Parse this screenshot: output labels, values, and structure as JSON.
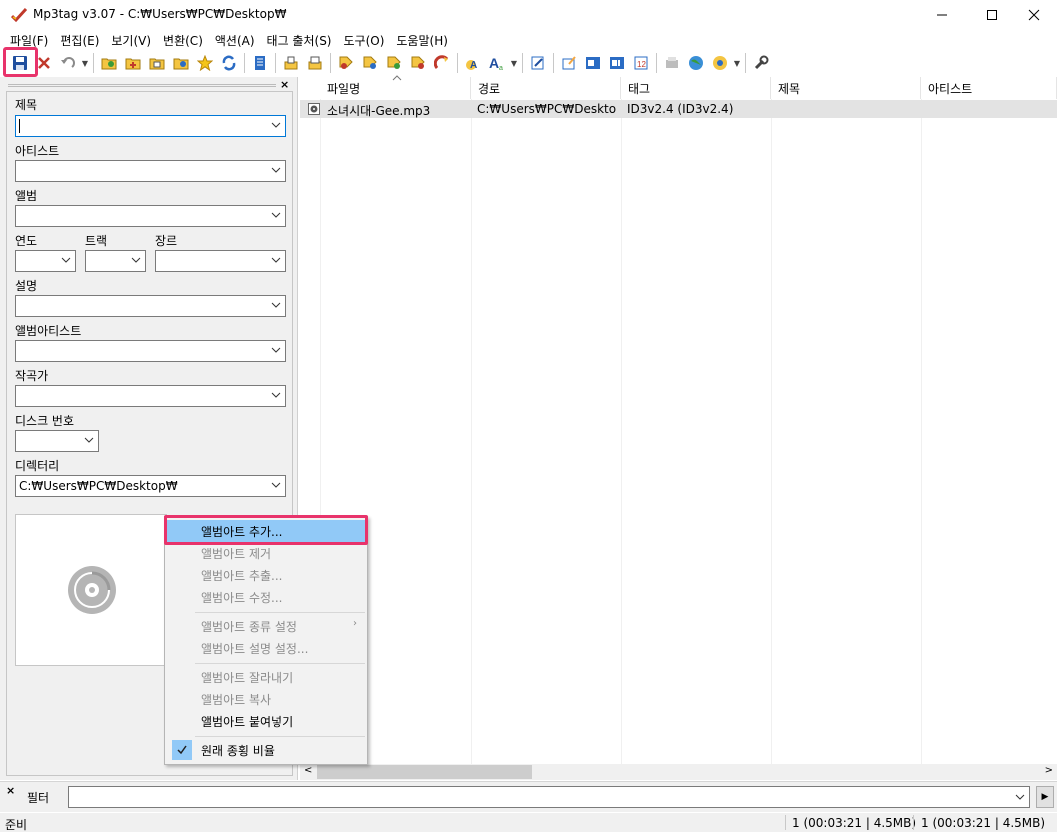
{
  "window": {
    "title": "Mp3tag v3.07  -  C:₩Users₩PC₩Desktop₩"
  },
  "menu": {
    "items": [
      "파일(F)",
      "편집(E)",
      "보기(V)",
      "변환(C)",
      "액션(A)",
      "태그 출처(S)",
      "도구(O)",
      "도움말(H)"
    ]
  },
  "toolbar": {
    "icons": [
      "save-icon",
      "remove-tag-icon",
      "undo-icon",
      "change-directory-icon",
      "add-directory-icon",
      "open-folder-icon",
      "favorites-icon",
      "refresh-icon",
      "playlist-icon",
      "save-playlist-icon",
      "print-icon",
      "convert-icon",
      "tag-filename-icon",
      "filename-filename-icon",
      "text-file-icon",
      "actions-icon",
      "quick-action-icon",
      "format-icon",
      "export-icon",
      "extended-tags-icon",
      "tag-sources-icon",
      "freedb-icon",
      "options-icon"
    ],
    "accent_color": "#e8336b"
  },
  "tag_panel": {
    "fields": {
      "title_label": "제목",
      "artist_label": "아티스트",
      "album_label": "앨범",
      "year_label": "연도",
      "track_label": "트랙",
      "genre_label": "장르",
      "comment_label": "설명",
      "album_artist_label": "앨범아티스트",
      "composer_label": "작곡가",
      "disc_label": "디스크 번호",
      "directory_label": "디렉터리",
      "directory_value": "C:₩Users₩PC₩Desktop₩"
    }
  },
  "file_list": {
    "columns": [
      "파일명",
      "경로",
      "태그",
      "제목",
      "아티스트"
    ],
    "sorted_column": "파일명",
    "rows": [
      {
        "filename": "소녀시대-Gee.mp3",
        "path": "C:₩Users₩PC₩Desktop₩",
        "tag": "ID3v2.4 (ID3v2.4)",
        "title": "",
        "artist": ""
      }
    ]
  },
  "context_menu": {
    "items": [
      {
        "label": "앨범아트 추가...",
        "enabled": true,
        "highlighted": true
      },
      {
        "label": "앨범아트 제거",
        "enabled": false
      },
      {
        "label": "앨범아트 추출...",
        "enabled": false
      },
      {
        "label": "앨범아트 수정...",
        "enabled": false
      },
      {
        "label": "앨범아트 종류 설정",
        "enabled": false,
        "submenu": true
      },
      {
        "label": "앨범아트 설명 설정...",
        "enabled": false
      },
      {
        "label": "앨범아트 잘라내기",
        "enabled": false
      },
      {
        "label": "앨범아트 복사",
        "enabled": false
      },
      {
        "label": "앨범아트 붙여넣기",
        "enabled": true
      },
      {
        "label": "원래 종횡 비율",
        "enabled": true,
        "checked": true
      }
    ]
  },
  "filter": {
    "label": "필터",
    "value": ""
  },
  "status": {
    "left": "준비",
    "selection": "1 (00:03:21 | 4.5MB)",
    "total": "1 (00:03:21 | 4.5MB)"
  }
}
